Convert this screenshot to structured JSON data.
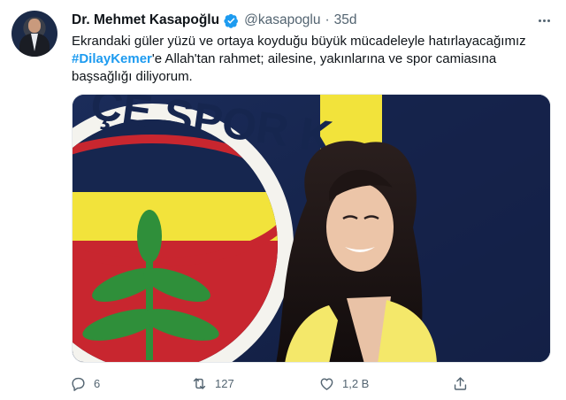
{
  "tweet": {
    "author": {
      "display_name": "Dr. Mehmet Kasapoğlu",
      "handle": "@kasapoglu",
      "verified": true
    },
    "separator": "·",
    "timestamp": "35d",
    "text": {
      "line1": "Ekrandaki güler yüzü ve ortaya koyduğu büyük mücadeleyle hatırlayacağımız",
      "hashtag": "#DilayKemer",
      "line2_rest": "'e Allah'tan rahmet; ailesine, yakınlarına ve spor camiasına",
      "line3": "başsağlığı diliyorum."
    },
    "media_banner_text": "ÇE SPOR K",
    "actions": {
      "reply_count": "6",
      "retweet_count": "127",
      "like_count": "1,2 B",
      "share_label": ""
    }
  },
  "colors": {
    "accent": "#1d9bf0",
    "text_primary": "#0f1419",
    "text_secondary": "#536471",
    "emblem_yellow": "#f2e33b",
    "emblem_navy": "#14254f",
    "emblem_red": "#c8262f",
    "jacket_yellow": "#f4e86a"
  },
  "icons": {
    "verified": "verified-badge-icon",
    "more": "more-options-icon",
    "reply": "reply-icon",
    "retweet": "retweet-icon",
    "like": "heart-icon",
    "share": "share-icon"
  }
}
